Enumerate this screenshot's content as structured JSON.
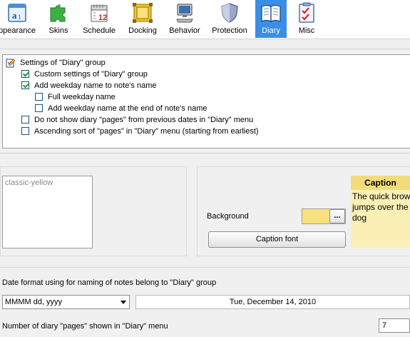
{
  "toolbar": {
    "active_tab": "Diary",
    "accent": "#3a8ee6",
    "tabs": [
      {
        "label": "ppearance",
        "icon": "appearance-icon"
      },
      {
        "label": "Skins",
        "icon": "puzzle-icon"
      },
      {
        "label": "Schedule",
        "icon": "calendar-icon"
      },
      {
        "label": "Docking",
        "icon": "docking-icon"
      },
      {
        "label": "Behavior",
        "icon": "computer-icon"
      },
      {
        "label": "Protection",
        "icon": "shield-icon"
      },
      {
        "label": "Diary",
        "icon": "book-icon"
      },
      {
        "label": "Misc",
        "icon": "checklist-icon"
      }
    ]
  },
  "settings": {
    "group_title": "Settings of \"Diary\" group",
    "items": [
      {
        "label": "Custom settings of \"Diary\" group",
        "checked": true
      },
      {
        "label": "Add weekday name to note's name",
        "checked": true
      },
      {
        "label": "Full weekday name",
        "checked": false
      },
      {
        "label": "Add weekday name at the end of note's name",
        "checked": false
      },
      {
        "label": "Do not show diary \"pages\" from previous dates in \"Diary\" menu",
        "checked": false
      },
      {
        "label": "Ascending sort of \"pages\" in \"Diary\" menu (starting from earliest)",
        "checked": false
      }
    ]
  },
  "skin": {
    "list_value": "classic-yellow",
    "background_label": "Background",
    "background_color": "#f7e07e",
    "browse_label": "...",
    "caption_font_label": "Caption font",
    "preview_title": "Caption",
    "preview_text": "The quick brown fox jumps over the lazy dog"
  },
  "date_format": {
    "label": "Date format using for naming of notes belong to \"Diary\" group",
    "value": "MMMM dd, yyyy",
    "preview": "Tue, December 14, 2010"
  },
  "pages": {
    "label": "Number of diary \"pages\" shown in \"Diary\" menu",
    "value": "7"
  }
}
